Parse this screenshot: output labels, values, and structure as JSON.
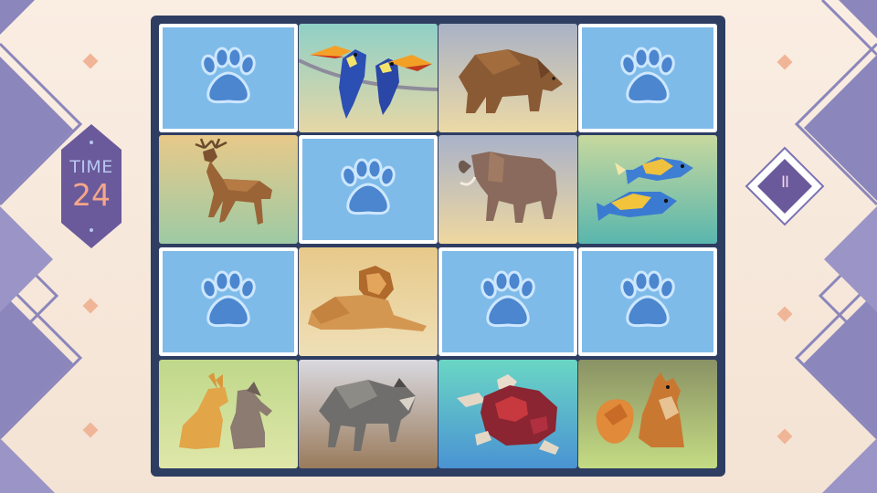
{
  "hud": {
    "timer_label": "TIME",
    "timer_value": "24",
    "pause_glyph": "II"
  },
  "colors": {
    "background": "#f7e9dc",
    "chevron": "#8b86bb",
    "board": "#2e3d62",
    "card_back": "#7fbbe9",
    "paw": "#4b86cf",
    "timer_panel": "#6a5a9b",
    "accent_diamond": "#f0b597"
  },
  "board": {
    "rows": 4,
    "cols": 4,
    "cards": [
      {
        "state": "face-down",
        "icon": "paw-icon"
      },
      {
        "state": "revealed",
        "animal": "toucan"
      },
      {
        "state": "revealed",
        "animal": "bear"
      },
      {
        "state": "face-down",
        "icon": "paw-icon"
      },
      {
        "state": "revealed",
        "animal": "deer"
      },
      {
        "state": "face-down",
        "icon": "paw-icon"
      },
      {
        "state": "revealed",
        "animal": "elephant"
      },
      {
        "state": "revealed",
        "animal": "fish"
      },
      {
        "state": "face-down",
        "icon": "paw-icon"
      },
      {
        "state": "revealed",
        "animal": "lion"
      },
      {
        "state": "face-down",
        "icon": "paw-icon"
      },
      {
        "state": "face-down",
        "icon": "paw-icon"
      },
      {
        "state": "revealed",
        "animal": "rabbits"
      },
      {
        "state": "revealed",
        "animal": "wolf"
      },
      {
        "state": "revealed",
        "animal": "sea-turtle"
      },
      {
        "state": "revealed",
        "animal": "squirrel"
      }
    ]
  }
}
